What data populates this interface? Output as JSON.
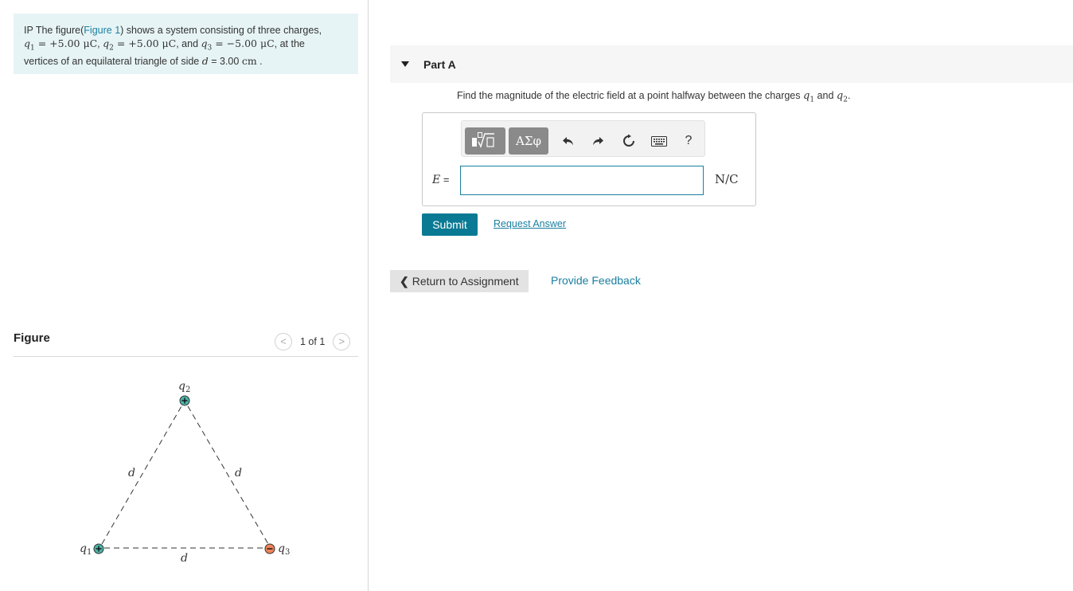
{
  "problem": {
    "prefix": "IP",
    "text_1": " The figure(",
    "figure_link": "Figure 1",
    "text_2": ") shows a system consisting of three charges,",
    "q1_label": "q",
    "q1_sub": "1",
    "q1_value": " = +5.00 μC",
    "q2_label": "q",
    "q2_sub": "2",
    "q2_value": " = +5.00 μC",
    "q3_label": "q",
    "q3_sub": "3",
    "q3_value": " = −5.00 μC",
    "and_text": ", and ",
    "comma": ", ",
    "text_3": ", at the",
    "text_4": "vertices of an equilateral triangle of side ",
    "d_symbol": "d",
    "d_value": " = 3.00 ",
    "d_unit": "cm",
    "period": " ."
  },
  "figure": {
    "title": "Figure",
    "pager_text": "1 of 1",
    "prev_symbol": "<",
    "next_symbol": ">",
    "charge_labels": {
      "q1": "q",
      "q1_sub": "1",
      "q2": "q",
      "q2_sub": "2",
      "q3": "q",
      "q3_sub": "3"
    },
    "side_label": "d",
    "positive_color": "#4db3a6",
    "negative_color": "#f0845a"
  },
  "part": {
    "label": "Part A",
    "question_pre": "Find the magnitude of the electric field at a point halfway between the charges ",
    "question_q1": "q",
    "question_q1_sub": "1",
    "question_and": " and ",
    "question_q2": "q",
    "question_q2_sub": "2",
    "question_end": "."
  },
  "answer": {
    "symbol": "E",
    "equals": " =",
    "value": "",
    "units": "N/C"
  },
  "toolbar": {
    "templates_icon": "templates-icon",
    "symbols_label": "ΑΣφ",
    "undo_icon": "undo-icon",
    "redo_icon": "redo-icon",
    "reset_icon": "reset-icon",
    "keyboard_icon": "keyboard-icon",
    "help_label": "?"
  },
  "actions": {
    "submit": "Submit",
    "request_answer": "Request Answer",
    "return_to_assignment": "Return to Assignment",
    "provide_feedback": "Provide Feedback"
  },
  "colors": {
    "accent": "#0a7a94",
    "link": "#1a7fa0",
    "intro_bg": "#e7f4f5"
  }
}
